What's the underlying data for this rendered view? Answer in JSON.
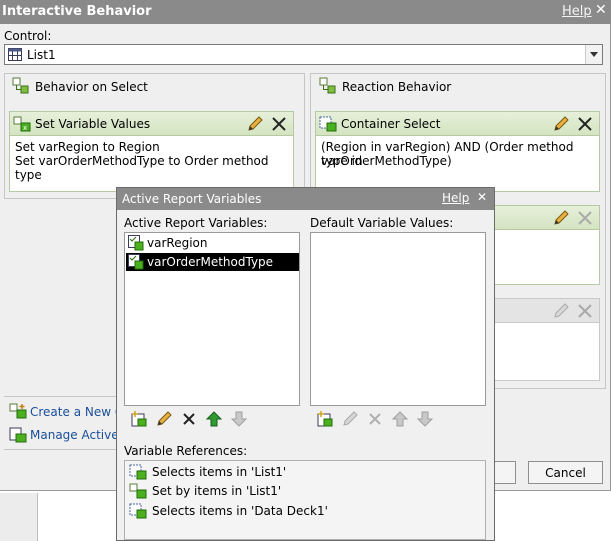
{
  "window": {
    "title": "Interactive Behavior",
    "help_label": "Help",
    "close_glyph": "✕"
  },
  "control": {
    "label": "Control:",
    "value": "List1"
  },
  "behavior_on_select": {
    "heading": "Behavior on Select",
    "panel_title": "Set Variable Values",
    "lines": [
      "Set varRegion to Region",
      "Set varOrderMethodType to Order method type"
    ]
  },
  "reaction_behavior": {
    "heading": "Reaction Behavior",
    "panel_title": "Container Select",
    "lines": [
      "(Region in varRegion) AND (Order method type in",
      "varOrderMethodType)"
    ]
  },
  "links": {
    "create_new": "Create a New C",
    "manage_active": "Manage Active"
  },
  "buttons": {
    "cancel": "Cancel"
  },
  "modal": {
    "title": "Active Report Variables",
    "help_label": "Help",
    "close_glyph": "✕",
    "variables_label": "Active Report Variables:",
    "variables": [
      "varRegion",
      "varOrderMethodType"
    ],
    "selected_index": 1,
    "defaults_label": "Default Variable Values:",
    "references_label": "Variable References:",
    "references": [
      {
        "text": "Selects items in 'List1'",
        "icon": "container-select-icon"
      },
      {
        "text": "Set by items in 'List1'",
        "icon": "set-variable-icon"
      },
      {
        "text": "Selects items in 'Data Deck1'",
        "icon": "container-select-icon"
      }
    ]
  },
  "colors": {
    "titlebar": "#8a8a8a",
    "panel_header": "#d4e4c1",
    "link": "#1a4f9a",
    "selection": "#000000"
  }
}
